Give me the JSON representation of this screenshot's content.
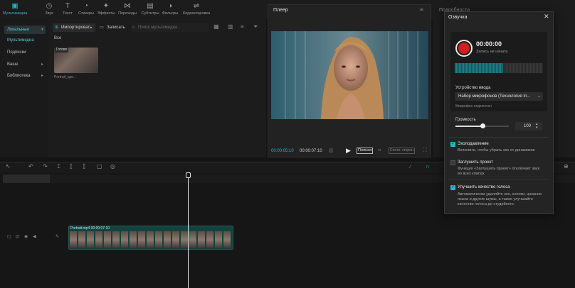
{
  "toolbar": {
    "items": [
      {
        "label": "Мультимедиа",
        "icon": "media-icon"
      },
      {
        "label": "Звук",
        "icon": "audio-icon"
      },
      {
        "label": "Текст",
        "icon": "text-icon"
      },
      {
        "label": "Стикеры",
        "icon": "sticker-icon"
      },
      {
        "label": "Эффекты",
        "icon": "effects-icon"
      },
      {
        "label": "Переходы",
        "icon": "transitions-icon"
      },
      {
        "label": "Субтитры",
        "icon": "subtitles-icon"
      },
      {
        "label": "Фильтры",
        "icon": "filters-icon"
      },
      {
        "label": "Корректировка",
        "icon": "adjust-icon"
      }
    ]
  },
  "sidebar": {
    "items": [
      {
        "label": "Локальные"
      },
      {
        "label": "Мультимедиа"
      },
      {
        "label": "Подписки"
      },
      {
        "label": "Ваше"
      },
      {
        "label": "Библиотека"
      }
    ]
  },
  "media": {
    "import_label": "Импортировать",
    "record_label": "Записать",
    "search_placeholder": "Поиск мультимедиа",
    "all_label": "Все",
    "thumb_badge": "Готово",
    "thumb_name": "Portrait_spe..."
  },
  "player": {
    "title": "Плеер",
    "time_current": "00:00:05:10",
    "time_total": "00:00:07:10",
    "full_label": "Полная",
    "ratio_label": "Соотн. сторон"
  },
  "props": {
    "title": "Подробности"
  },
  "timeline": {
    "clip_label": "Portrait.mp4  00:00:07:10"
  },
  "dialog": {
    "title": "Озвучка",
    "rec_time": "00:00:00",
    "rec_status": "Запись не начата",
    "meter_level": 0.55,
    "device_label": "Устройство ввода",
    "device_value": "Набор микрофонов (Технология In...",
    "device_hint": "Микрофон подключен",
    "volume_label": "Громкость",
    "volume_value": "100",
    "volume_fraction": 0.5,
    "options": [
      {
        "title": "Эхоподавление",
        "desc": "Включите, чтобы убрать эхо от динамиков",
        "checked": true
      },
      {
        "title": "Заглушить проект",
        "desc": "Функция «Заглушить проект» отключает звук во всех клипах",
        "checked": false
      },
      {
        "title": "Улучшить качество голоса",
        "desc": "Автоматически удаляйте эхо, хлопки, цокание языка и другие шумы, а также улучшайте качество голоса до студийного.",
        "checked": true
      }
    ]
  }
}
